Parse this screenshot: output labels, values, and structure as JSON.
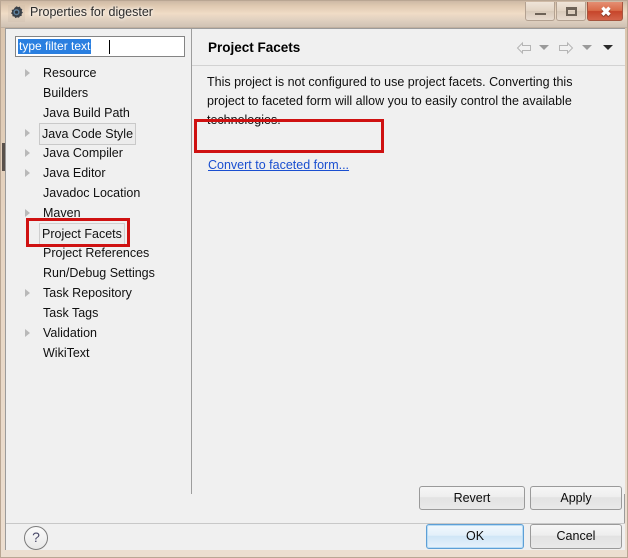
{
  "window": {
    "title": "Properties for digester",
    "app_icon": "gear-icon",
    "caption": {
      "minimize": "minimize-icon",
      "maximize": "restore-icon",
      "close_label": "✖"
    }
  },
  "sidebar": {
    "filter": {
      "value": "type filter text",
      "placeholder": "type filter text",
      "selected": true
    },
    "items": [
      {
        "label": "Resource",
        "expandable": true,
        "state": "normal"
      },
      {
        "label": "Builders",
        "expandable": false,
        "state": "normal"
      },
      {
        "label": "Java Build Path",
        "expandable": false,
        "state": "normal"
      },
      {
        "label": "Java Code Style",
        "expandable": true,
        "state": "focus"
      },
      {
        "label": "Java Compiler",
        "expandable": true,
        "state": "normal"
      },
      {
        "label": "Java Editor",
        "expandable": true,
        "state": "normal"
      },
      {
        "label": "Javadoc Location",
        "expandable": false,
        "state": "normal"
      },
      {
        "label": "Maven",
        "expandable": true,
        "state": "normal"
      },
      {
        "label": "Project Facets",
        "expandable": false,
        "state": "selected"
      },
      {
        "label": "Project References",
        "expandable": false,
        "state": "normal"
      },
      {
        "label": "Run/Debug Settings",
        "expandable": false,
        "state": "normal"
      },
      {
        "label": "Task Repository",
        "expandable": true,
        "state": "normal"
      },
      {
        "label": "Task Tags",
        "expandable": false,
        "state": "normal"
      },
      {
        "label": "Validation",
        "expandable": true,
        "state": "normal"
      },
      {
        "label": "WikiText",
        "expandable": false,
        "state": "normal"
      }
    ]
  },
  "main": {
    "title": "Project Facets",
    "description": "This project is not configured to use project facets. Converting this project to faceted form will allow you to easily control the available technologies.",
    "link": "Convert to faceted form...",
    "nav": {
      "back_icon": "back-arrow-icon",
      "back_menu_icon": "chevron-down-icon",
      "forward_icon": "forward-arrow-icon",
      "forward_menu_icon": "chevron-down-icon",
      "menu_icon": "chevron-down-icon"
    }
  },
  "buttons": {
    "revert": "Revert",
    "apply": "Apply",
    "ok": "OK",
    "cancel": "Cancel",
    "help": "?"
  },
  "annotations": {
    "highlight_color": "#cf1111",
    "boxes": [
      {
        "target": "Convert to faceted form..."
      },
      {
        "target": "Project Facets"
      }
    ]
  },
  "colors": {
    "link": "#1a4fd0",
    "selection": "#2a7fe0",
    "panel": "#f0f0f0",
    "titlebar": "#e6d4c1",
    "default_button_border": "#5d9fd6"
  }
}
